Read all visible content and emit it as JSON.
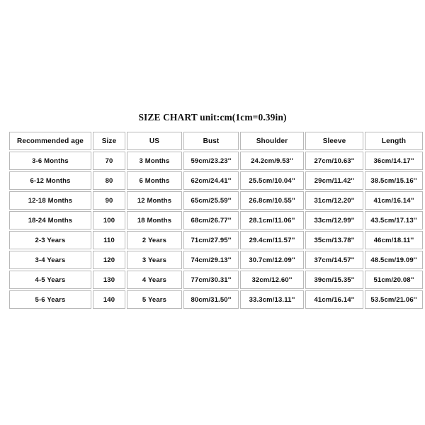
{
  "title": "SIZE CHART unit:cm(1cm=0.39in)",
  "table": {
    "headers": [
      "Recommended age",
      "Size",
      "US",
      "Bust",
      "Shoulder",
      "Sleeve",
      "Length"
    ],
    "rows": [
      [
        "3-6 Months",
        "70",
        "3 Months",
        "59cm/23.23''",
        "24.2cm/9.53''",
        "27cm/10.63''",
        "36cm/14.17''"
      ],
      [
        "6-12 Months",
        "80",
        "6 Months",
        "62cm/24.41''",
        "25.5cm/10.04''",
        "29cm/11.42''",
        "38.5cm/15.16''"
      ],
      [
        "12-18 Months",
        "90",
        "12 Months",
        "65cm/25.59''",
        "26.8cm/10.55''",
        "31cm/12.20''",
        "41cm/16.14''"
      ],
      [
        "18-24 Months",
        "100",
        "18 Months",
        "68cm/26.77''",
        "28.1cm/11.06''",
        "33cm/12.99''",
        "43.5cm/17.13''"
      ],
      [
        "2-3 Years",
        "110",
        "2 Years",
        "71cm/27.95''",
        "29.4cm/11.57''",
        "35cm/13.78''",
        "46cm/18.11''"
      ],
      [
        "3-4 Years",
        "120",
        "3 Years",
        "74cm/29.13''",
        "30.7cm/12.09''",
        "37cm/14.57''",
        "48.5cm/19.09''"
      ],
      [
        "4-5 Years",
        "130",
        "4 Years",
        "77cm/30.31''",
        "32cm/12.60''",
        "39cm/15.35''",
        "51cm/20.08''"
      ],
      [
        "5-6 Years",
        "140",
        "5 Years",
        "80cm/31.50''",
        "33.3cm/13.11''",
        "41cm/16.14''",
        "53.5cm/21.06''"
      ]
    ]
  },
  "colors": {
    "background": "#ffffff",
    "text": "#101010",
    "cell_border": "#b9b9b9"
  }
}
